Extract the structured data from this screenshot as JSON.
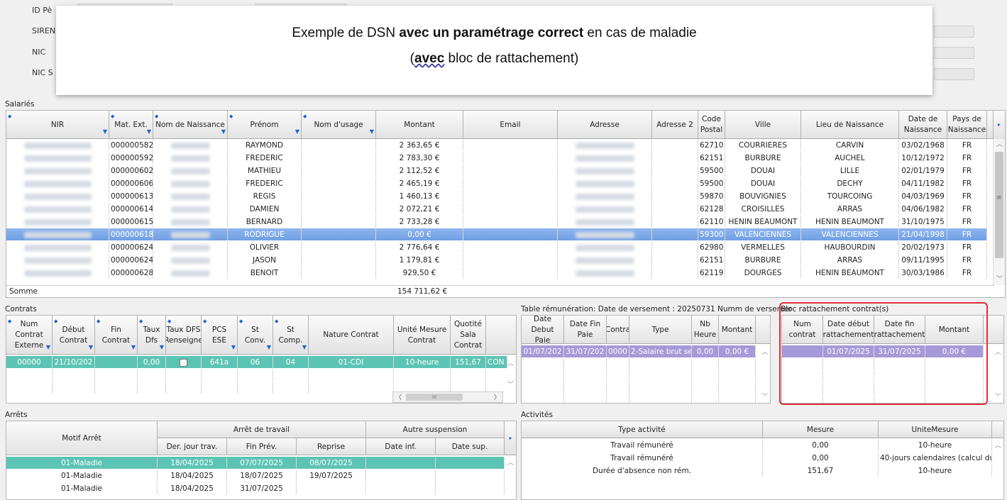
{
  "background_fields": {
    "id_label": "ID Pè",
    "siren_label": "SIREN",
    "nic_label": "NIC",
    "nic_s_label": "NIC S"
  },
  "banner": {
    "line1_pre": "Exemple de DSN ",
    "line1_bold": "avec un paramétrage correct",
    "line1_post": " en cas de maladie",
    "line2_pre": "(",
    "line2_bold": "avec",
    "line2_post": " bloc de rattachement)"
  },
  "salaries": {
    "title": "Salariés",
    "columns": [
      "NIR",
      "Mat. Ext.",
      "Nom de Naissance",
      "Prénom",
      "Nom d'usage",
      "Montant",
      "Email",
      "Adresse",
      "Adresse 2",
      "Code\nPostal",
      "Ville",
      "Lieu de Naissance",
      "Date de\nNaissance",
      "Pays de\nNaissance"
    ],
    "rows": [
      {
        "mat": "000000582",
        "prenom": "RAYMOND",
        "montant": "2 363,65 €",
        "cp": "62710",
        "ville": "COURRIERES",
        "lieu": "CARVIN",
        "date": "03/02/1968",
        "pays": "FR"
      },
      {
        "mat": "000000592",
        "prenom": "FREDERIC",
        "montant": "2 783,30 €",
        "cp": "62151",
        "ville": "BURBURE",
        "lieu": "AUCHEL",
        "date": "10/12/1972",
        "pays": "FR"
      },
      {
        "mat": "000000602",
        "prenom": "MATHIEU",
        "montant": "2 112,52 €",
        "cp": "59500",
        "ville": "DOUAI",
        "lieu": "LILLE",
        "date": "02/01/1979",
        "pays": "FR"
      },
      {
        "mat": "000000606",
        "prenom": "FREDERIC",
        "montant": "2 465,19 €",
        "cp": "59500",
        "ville": "DOUAI",
        "lieu": "DECHY",
        "date": "04/11/1982",
        "pays": "FR"
      },
      {
        "mat": "000000613",
        "prenom": "REGIS",
        "montant": "1 460,13 €",
        "cp": "59870",
        "ville": "BOUVIGNIES",
        "lieu": "TOURCOING",
        "date": "04/03/1969",
        "pays": "FR"
      },
      {
        "mat": "000000614",
        "prenom": "DAMIEN",
        "montant": "2 072,21 €",
        "cp": "62128",
        "ville": "CROISILLES",
        "lieu": "ARRAS",
        "date": "04/06/1982",
        "pays": "FR"
      },
      {
        "mat": "000000615",
        "prenom": "BERNARD",
        "montant": "2 733,28 €",
        "cp": "62110",
        "ville": "HENIN BEAUMONT",
        "lieu": "HENIN BEAUMONT",
        "date": "31/10/1975",
        "pays": "FR"
      },
      {
        "mat": "000000618",
        "prenom": "RODRIGUE",
        "montant": "0,00 €",
        "cp": "59300",
        "ville": "VALENCIENNES",
        "lieu": "VALENCIENNES",
        "date": "21/04/1998",
        "pays": "FR"
      },
      {
        "mat": "000000624",
        "prenom": "OLIVIER",
        "montant": "2 776,64 €",
        "cp": "62980",
        "ville": "VERMELLES",
        "lieu": "HAUBOURDIN",
        "date": "20/02/1973",
        "pays": "FR"
      },
      {
        "mat": "000000624",
        "prenom": "JASON",
        "montant": "1 179,81 €",
        "cp": "62151",
        "ville": "BURBURE",
        "lieu": "ARRAS",
        "date": "09/11/1995",
        "pays": "FR"
      },
      {
        "mat": "000000628",
        "prenom": "BENOIT",
        "montant": "929,50 €",
        "cp": "62119",
        "ville": "DOURGES",
        "lieu": "HENIN BEAUMONT",
        "date": "30/03/1986",
        "pays": "FR"
      }
    ],
    "somme_label": "Somme",
    "somme_value": "154 711,62 €"
  },
  "contrats": {
    "title": "Contrats",
    "columns": [
      "Num\nContrat\nExterne",
      "Début\nContrat",
      "Fin\nContrat",
      "Taux\nDfs",
      "Taux DFS\nRenseigne",
      "PCS\nESE",
      "St\nConv.",
      "St\nComp.",
      "Nature Contrat",
      "Unité Mesure\nContrat",
      "Quotité\nSala\nContrat"
    ],
    "row": [
      "00000",
      "21/10/202",
      "",
      "0,00",
      "",
      "641a",
      "06",
      "04",
      "01-CDI",
      "10-heure",
      "151,67",
      "CON"
    ],
    "hscroll_mid": "III"
  },
  "remuneration": {
    "title": "Table rémunération: Date de versement : 20250731 Numm de versemer",
    "columns": [
      "Date Debut\nPaie",
      "Date Fin\nPaie",
      "Contra",
      "Type",
      "Nb\nHeure",
      "Montant"
    ],
    "row": [
      "01/07/202",
      "31/07/202",
      "0000",
      "2-Salaire brut se",
      "0,00",
      "0,00 €"
    ]
  },
  "rattachement": {
    "title": "Bloc rattachement contrat(s)",
    "columns": [
      "Num\ncontrat",
      "Date début\nrattachement",
      "Date fin\nrattachement",
      "Montant"
    ],
    "row": [
      "",
      "01/07/2025",
      "31/07/2025",
      "0,00 €"
    ]
  },
  "arrets": {
    "title": "Arrêts",
    "motif_header": "Motif Arrêt",
    "group1": "Arrêt de travail",
    "group2": "Autre suspension",
    "subcols": [
      "Der. jour trav.",
      "Fin Prév.",
      "Reprise",
      "Date inf.",
      "Date sup."
    ],
    "rows": [
      [
        "01-Maladie",
        "18/04/2025",
        "07/07/2025",
        "08/07/2025",
        "",
        ""
      ],
      [
        "01-Maladie",
        "18/04/2025",
        "18/07/2025",
        "19/07/2025",
        "",
        ""
      ],
      [
        "01-Maladie",
        "18/04/2025",
        "31/07/2025",
        "",
        "",
        ""
      ]
    ]
  },
  "activites": {
    "title": "Activités",
    "columns": [
      "Type activité",
      "Mesure",
      "UniteMesure"
    ],
    "rows": [
      [
        "Travail rémunéré",
        "0,00",
        "10-heure"
      ],
      [
        "Travail rémunéré",
        "0,00",
        "40-jours calendaires (calcul du"
      ],
      [
        "Durée d'absence non rém.",
        "151,67",
        "10-heure"
      ]
    ]
  },
  "colors": {
    "selection_blue": "#7aa6e8",
    "teal": "#5cc4b4",
    "purple": "#a699d8",
    "highlight_border": "#e0303a"
  }
}
